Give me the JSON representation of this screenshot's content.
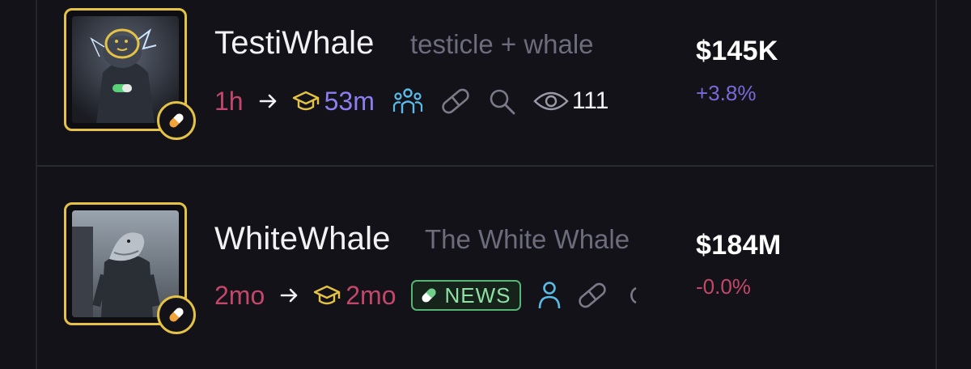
{
  "tokens": [
    {
      "name": "TestiWhale",
      "tagline": "testicle + whale",
      "age": "1h",
      "arrow": "→",
      "graduated_age": "53m",
      "views": "111",
      "price": "$145K",
      "change": "+3.8%",
      "icons": [
        "arrow-right-icon",
        "graduation-cap-icon",
        "holders-group-icon",
        "link-icon",
        "search-icon",
        "eye-icon"
      ]
    },
    {
      "name": "WhiteWhale",
      "tagline": "The White Whale",
      "age": "2mo",
      "arrow": "→",
      "graduated_age": "2mo",
      "news_label": "NEWS",
      "price": "$184M",
      "change": "-0.0%",
      "icons": [
        "arrow-right-icon",
        "graduation-cap-icon",
        "pill-icon",
        "user-icon",
        "link-icon",
        "search-icon"
      ]
    }
  ],
  "colors": {
    "background": "#121218",
    "avatar_border": "#e4c246",
    "age": "#c4476a",
    "positive_change": "#7a6ad8",
    "negative_change": "#c4476a",
    "news_border": "#58b474"
  }
}
